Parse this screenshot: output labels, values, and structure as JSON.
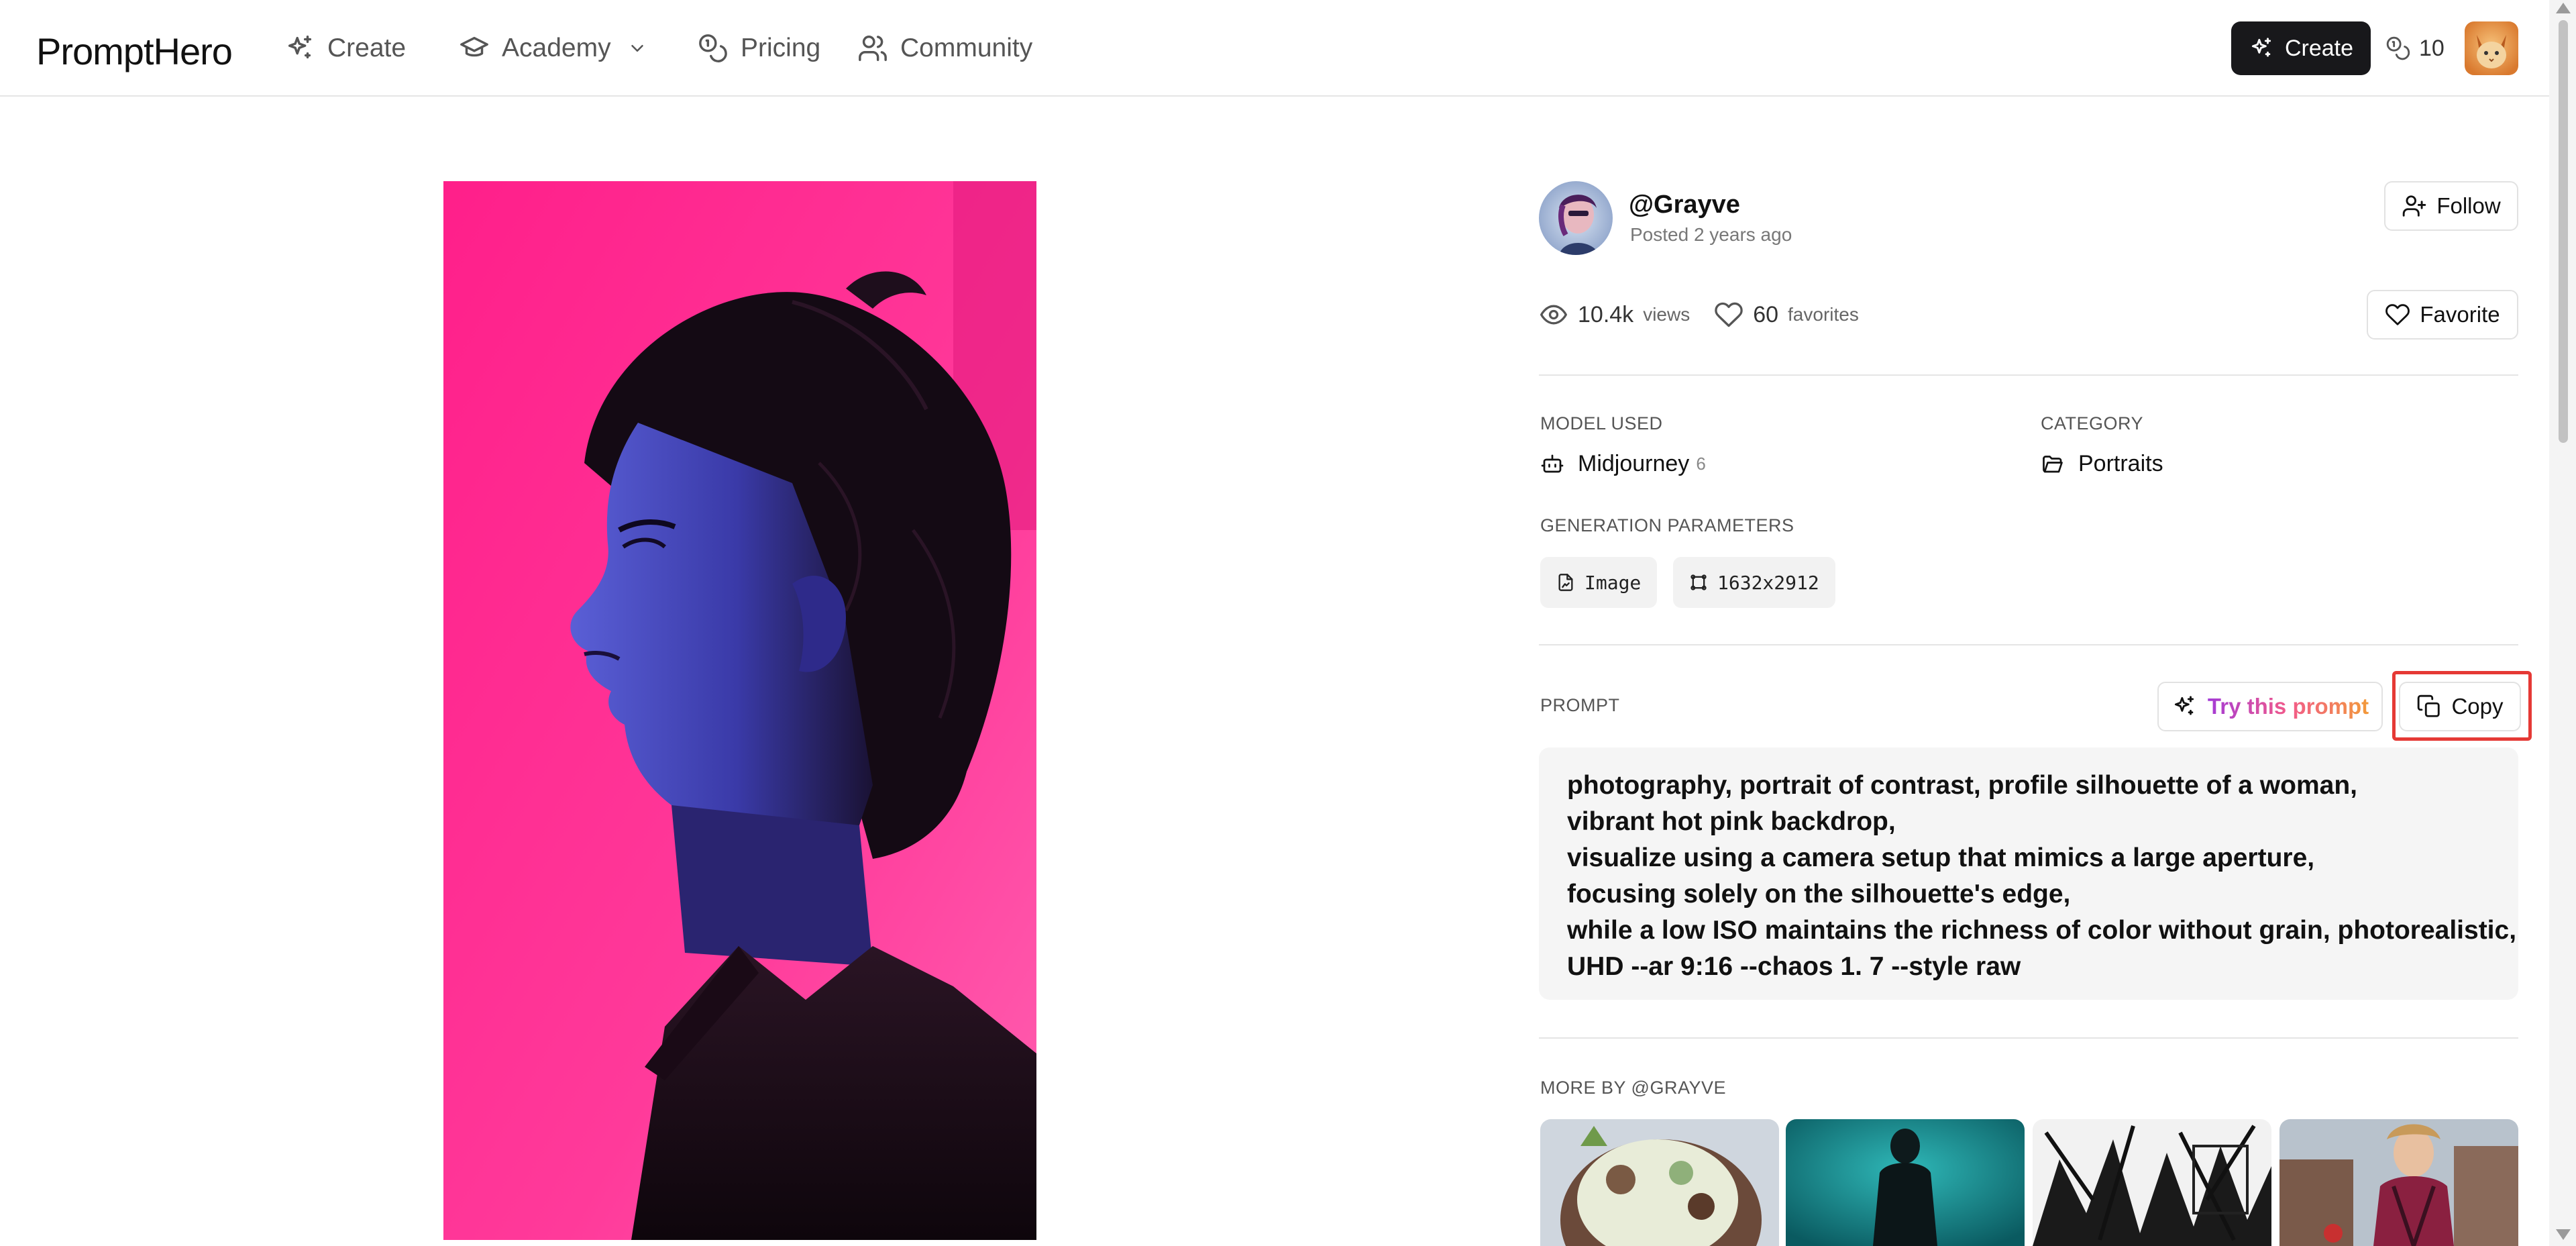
{
  "nav": {
    "logo": "PromptHero",
    "items": [
      {
        "label": "Create",
        "icon": "sparkles-icon"
      },
      {
        "label": "Academy",
        "icon": "graduation-cap-icon"
      },
      {
        "label": "Pricing",
        "icon": "coins-icon"
      },
      {
        "label": "Community",
        "icon": "users-icon"
      }
    ],
    "create_button": "Create",
    "credits": "10"
  },
  "author": {
    "name": "@Grayve",
    "posted": "Posted 2 years ago",
    "follow_label": "Follow"
  },
  "stats": {
    "views_count": "10.4k",
    "views_label": "views",
    "favorites_count": "60",
    "favorites_label": "favorites",
    "favorite_button": "Favorite"
  },
  "meta": {
    "model_label": "MODEL USED",
    "model_value": "Midjourney",
    "model_version": "6",
    "category_label": "CATEGORY",
    "category_value": "Portraits",
    "params_label": "GENERATION PARAMETERS",
    "params": [
      "Image",
      "1632x2912"
    ]
  },
  "prompt": {
    "label": "PROMPT",
    "try_button": "Try this prompt",
    "copy_button": "Copy",
    "lines": [
      "photography, portrait of contrast, profile silhouette of a woman,",
      "vibrant hot pink backdrop,",
      "visualize using a camera setup that mimics a large aperture,",
      "focusing solely on the silhouette's edge,",
      "while a low ISO maintains the richness of color without grain, photorealistic,",
      "UHD --ar 9:16 --chaos 1. 7 --style raw"
    ]
  },
  "more": {
    "label": "MORE BY @GRAYVE"
  },
  "colors": {
    "accent_dark": "#18181b",
    "highlight_red": "#e53935",
    "image_pink": "#ff1f8a"
  }
}
